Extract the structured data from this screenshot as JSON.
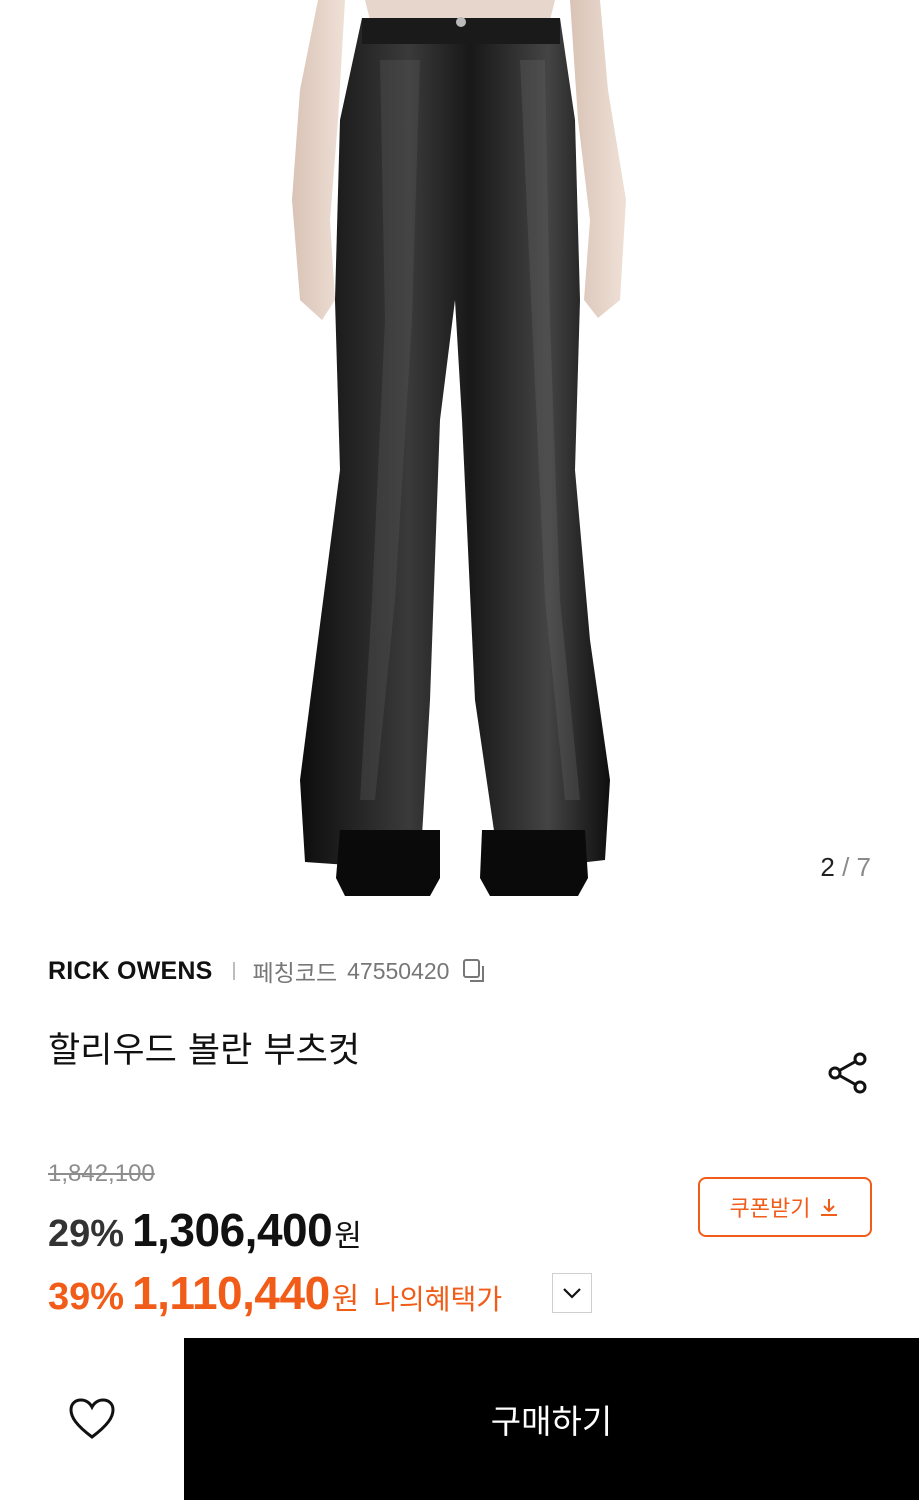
{
  "gallery": {
    "current": "2",
    "separator": "/",
    "total": "7"
  },
  "product": {
    "brand": "RICK OWENS",
    "code_label": "페칭코드",
    "code_value": "47550420",
    "title": "할리우드 볼란 부츠컷"
  },
  "pricing": {
    "original": "1,842,100",
    "sale_percent": "29%",
    "sale_amount": "1,306,400",
    "currency": "원",
    "benefit_percent": "39%",
    "benefit_amount": "1,110,440",
    "benefit_label": "나의혜택가",
    "accent_color": "#f25c19"
  },
  "coupon": {
    "label": "쿠폰받기"
  },
  "actions": {
    "buy_label": "구매하기"
  },
  "icons": {
    "copy": "copy-icon",
    "share": "share-icon",
    "download": "download-icon",
    "chevron": "chevron-down-icon",
    "wishlist": "heart-icon"
  }
}
